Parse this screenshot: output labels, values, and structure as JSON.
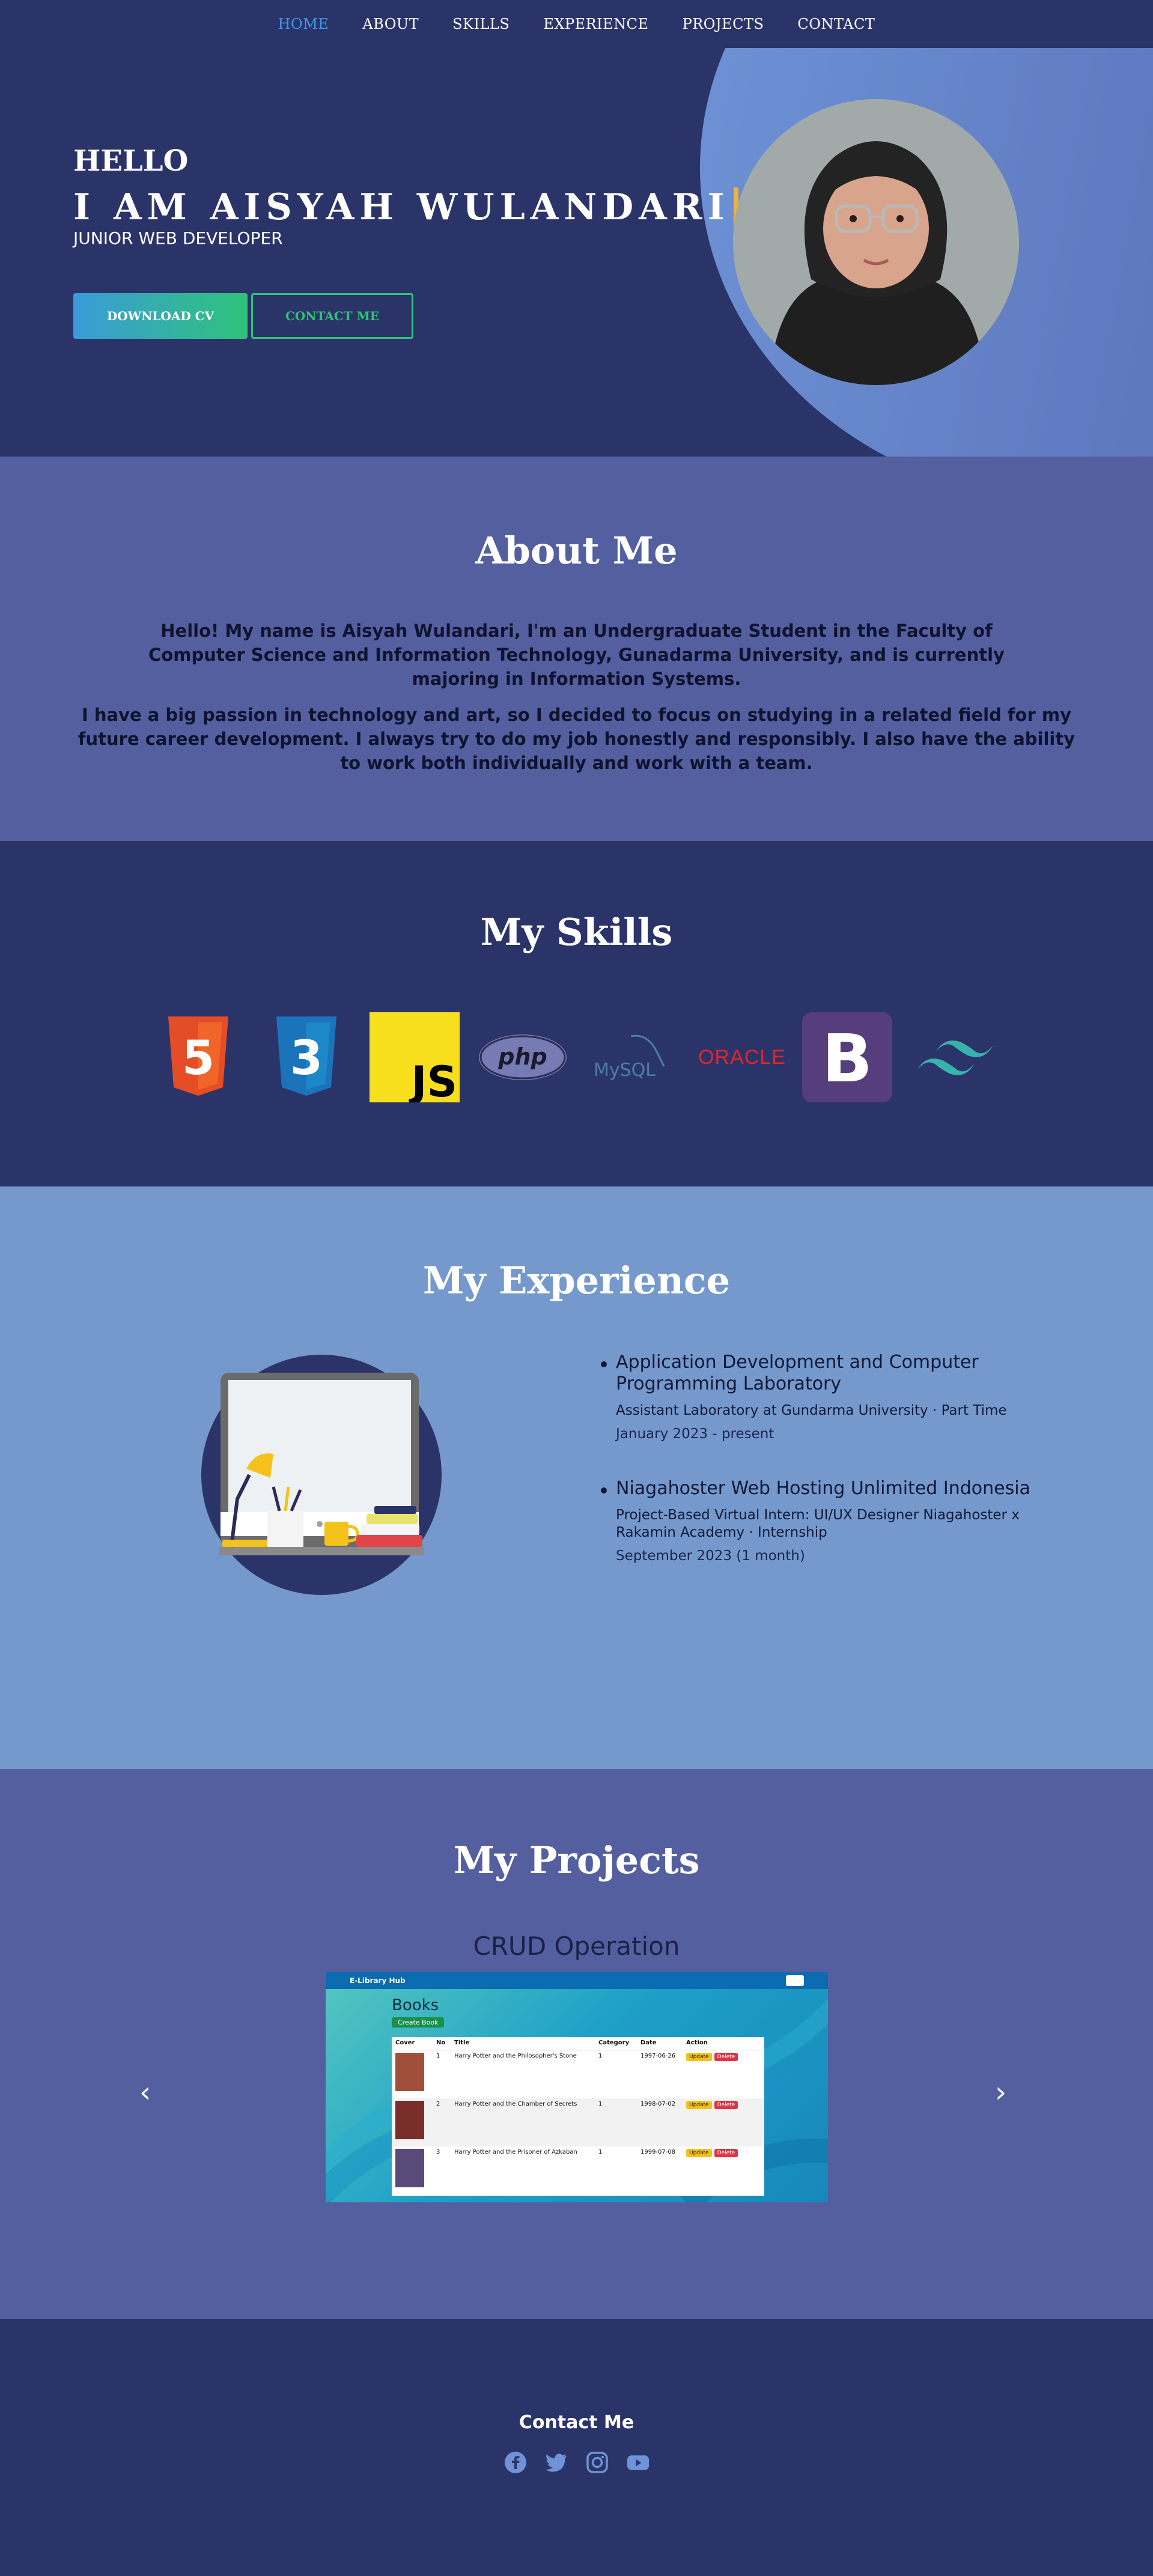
{
  "nav": {
    "items": [
      {
        "label": "HOME",
        "active": true
      },
      {
        "label": "ABOUT"
      },
      {
        "label": "SKILLS"
      },
      {
        "label": "EXPERIENCE"
      },
      {
        "label": "PROJECTS"
      },
      {
        "label": "CONTACT"
      }
    ]
  },
  "hero": {
    "greeting": "HELLO",
    "headline": "I AM AISYAH WULANDARI",
    "role": "JUNIOR WEB DEVELOPER",
    "download_cv": "DOWNLOAD CV",
    "contact_me": "CONTACT ME"
  },
  "about": {
    "title": "About Me",
    "p1": "Hello! My name is Aisyah Wulandari, I'm an Undergraduate Student in the Faculty of Computer Science and Information Technology, Gunadarma University, and is currently majoring in Information Systems.",
    "p2": "I have a big passion in technology and art, so I decided to focus on studying in a related field for my future career development. I always try to do my job honestly and responsibly. I also have the ability to work both individually and work with a team."
  },
  "skills": {
    "title": "My Skills",
    "logos": {
      "html": "5",
      "css": "3",
      "js": "JS",
      "php": "php",
      "mysql": "MySQL",
      "oracle": "ORACLE",
      "bootstrap": "B"
    },
    "icons": [
      "html5-logo",
      "css3-logo",
      "javascript-logo",
      "php-logo",
      "mysql-logo",
      "oracle-logo",
      "bootstrap-logo",
      "tailwind-logo"
    ]
  },
  "experience": {
    "title": "My Experience",
    "items": [
      {
        "title": "Application Development and Computer Programming Laboratory",
        "subtitle": "Assistant Laboratory at Gundarma University · Part Time",
        "date": "January 2023 - present"
      },
      {
        "title": "Niagahoster Web Hosting Unlimited Indonesia",
        "subtitle": "Project-Based Virtual Intern: UI/UX Designer Niagahoster x Rakamin Academy · Internship",
        "date": "September 2023 (1 month)"
      }
    ]
  },
  "projects": {
    "title": "My Projects",
    "current": "CRUD Operation",
    "prev_arrow": "‹",
    "next_arrow": "›",
    "screenshot": {
      "app_name": "E-Library Hub",
      "heading": "Books",
      "create_button": "Create Book",
      "columns": [
        "Cover",
        "No",
        "Title",
        "Category",
        "Date",
        "Action"
      ],
      "rows": [
        {
          "no": "1",
          "title": "Harry Potter and the Philosopher's Stone",
          "category": "1",
          "date": "1997-06-26"
        },
        {
          "no": "2",
          "title": "Harry Potter and the Chamber of Secrets",
          "category": "1",
          "date": "1998-07-02"
        },
        {
          "no": "3",
          "title": "Harry Potter and the Prisoner of Azkaban",
          "category": "1",
          "date": "1999-07-08"
        }
      ],
      "update_label": "Update",
      "delete_label": "Delete"
    }
  },
  "footer": {
    "title": "Contact Me",
    "socials": [
      "facebook-icon",
      "twitter-icon",
      "instagram-icon",
      "youtube-icon"
    ]
  },
  "colors": {
    "navy": "#2b3469",
    "indigo": "#535f9e",
    "sky": "#7599cc",
    "active_nav": "#3b9ae8",
    "accent_green": "#2fc37a",
    "caret": "#f1b13b"
  }
}
